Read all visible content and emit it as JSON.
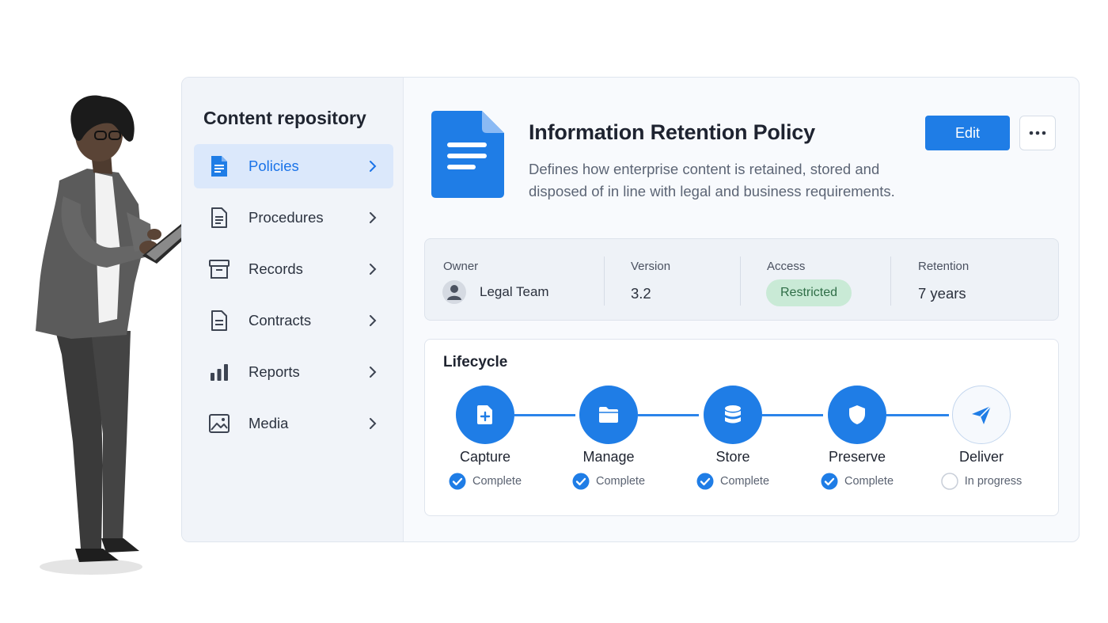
{
  "sidebar": {
    "title": "Content repository",
    "items": [
      {
        "label": "Policies",
        "icon": "document-icon",
        "active": true
      },
      {
        "label": "Procedures",
        "icon": "document-icon",
        "active": false
      },
      {
        "label": "Records",
        "icon": "archive-box-icon",
        "active": false
      },
      {
        "label": "Contracts",
        "icon": "document-icon",
        "active": false
      },
      {
        "label": "Reports",
        "icon": "bar-chart-icon",
        "active": false
      },
      {
        "label": "Media",
        "icon": "image-icon",
        "active": false
      }
    ]
  },
  "document": {
    "title": "Information Retention Policy",
    "description": "Defines how enterprise content is retained, stored and disposed of in line with legal and business requirements."
  },
  "actions": {
    "edit_label": "Edit",
    "more_icon": "more-horizontal-icon"
  },
  "meta": {
    "owner_label": "Owner",
    "owner_value": "Legal Team",
    "version_label": "Version",
    "version_value": "3.2",
    "access_label": "Access",
    "access_value": "Restricted",
    "retention_label": "Retention",
    "retention_value": "7 years"
  },
  "lifecycle": {
    "title": "Lifecycle",
    "stages": [
      {
        "name": "Capture",
        "status": "Complete",
        "icon": "file-add-icon"
      },
      {
        "name": "Manage",
        "status": "Complete",
        "icon": "folder-icon"
      },
      {
        "name": "Store",
        "status": "Complete",
        "icon": "database-icon"
      },
      {
        "name": "Preserve",
        "status": "Complete",
        "icon": "shield-icon"
      },
      {
        "name": "Deliver",
        "status": "In progress",
        "icon": "send-icon"
      }
    ]
  },
  "colors": {
    "accent": "#1f7de6",
    "active_nav_bg": "#dbe8fb",
    "restricted_badge_bg": "#c9ead6",
    "restricted_badge_text": "#2f6e47"
  }
}
